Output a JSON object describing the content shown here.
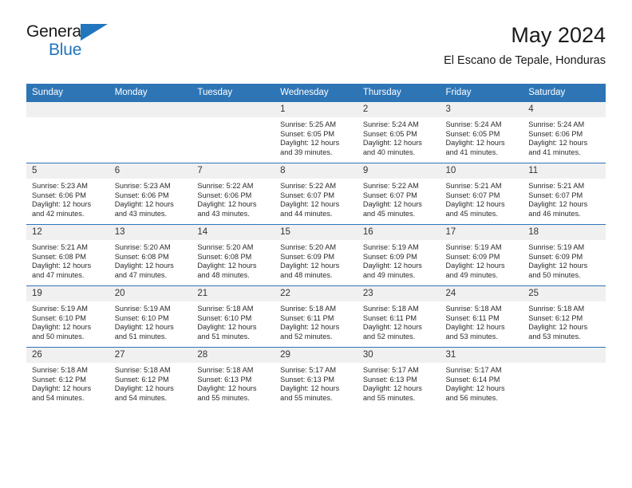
{
  "brand": {
    "name_top": "General",
    "name_bottom": "Blue",
    "accent_color": "#2176bd"
  },
  "header": {
    "title": "May 2024",
    "subtitle": "El Escano de Tepale, Honduras"
  },
  "theme": {
    "header_blue": "#2e75b6",
    "daynum_band": "#f0f0f0",
    "text": "#2b2b2b"
  },
  "weekdays": [
    "Sunday",
    "Monday",
    "Tuesday",
    "Wednesday",
    "Thursday",
    "Friday",
    "Saturday"
  ],
  "labels": {
    "sunrise_prefix": "Sunrise:",
    "sunset_prefix": "Sunset:",
    "daylight_prefix": "Daylight:"
  },
  "weeks": [
    [
      {
        "day": "",
        "line1": "",
        "line2": "",
        "line3": "",
        "line4": ""
      },
      {
        "day": "",
        "line1": "",
        "line2": "",
        "line3": "",
        "line4": ""
      },
      {
        "day": "",
        "line1": "",
        "line2": "",
        "line3": "",
        "line4": ""
      },
      {
        "day": "1",
        "line1": "Sunrise: 5:25 AM",
        "line2": "Sunset: 6:05 PM",
        "line3": "Daylight: 12 hours",
        "line4": "and 39 minutes."
      },
      {
        "day": "2",
        "line1": "Sunrise: 5:24 AM",
        "line2": "Sunset: 6:05 PM",
        "line3": "Daylight: 12 hours",
        "line4": "and 40 minutes."
      },
      {
        "day": "3",
        "line1": "Sunrise: 5:24 AM",
        "line2": "Sunset: 6:05 PM",
        "line3": "Daylight: 12 hours",
        "line4": "and 41 minutes."
      },
      {
        "day": "4",
        "line1": "Sunrise: 5:24 AM",
        "line2": "Sunset: 6:06 PM",
        "line3": "Daylight: 12 hours",
        "line4": "and 41 minutes."
      }
    ],
    [
      {
        "day": "5",
        "line1": "Sunrise: 5:23 AM",
        "line2": "Sunset: 6:06 PM",
        "line3": "Daylight: 12 hours",
        "line4": "and 42 minutes."
      },
      {
        "day": "6",
        "line1": "Sunrise: 5:23 AM",
        "line2": "Sunset: 6:06 PM",
        "line3": "Daylight: 12 hours",
        "line4": "and 43 minutes."
      },
      {
        "day": "7",
        "line1": "Sunrise: 5:22 AM",
        "line2": "Sunset: 6:06 PM",
        "line3": "Daylight: 12 hours",
        "line4": "and 43 minutes."
      },
      {
        "day": "8",
        "line1": "Sunrise: 5:22 AM",
        "line2": "Sunset: 6:07 PM",
        "line3": "Daylight: 12 hours",
        "line4": "and 44 minutes."
      },
      {
        "day": "9",
        "line1": "Sunrise: 5:22 AM",
        "line2": "Sunset: 6:07 PM",
        "line3": "Daylight: 12 hours",
        "line4": "and 45 minutes."
      },
      {
        "day": "10",
        "line1": "Sunrise: 5:21 AM",
        "line2": "Sunset: 6:07 PM",
        "line3": "Daylight: 12 hours",
        "line4": "and 45 minutes."
      },
      {
        "day": "11",
        "line1": "Sunrise: 5:21 AM",
        "line2": "Sunset: 6:07 PM",
        "line3": "Daylight: 12 hours",
        "line4": "and 46 minutes."
      }
    ],
    [
      {
        "day": "12",
        "line1": "Sunrise: 5:21 AM",
        "line2": "Sunset: 6:08 PM",
        "line3": "Daylight: 12 hours",
        "line4": "and 47 minutes."
      },
      {
        "day": "13",
        "line1": "Sunrise: 5:20 AM",
        "line2": "Sunset: 6:08 PM",
        "line3": "Daylight: 12 hours",
        "line4": "and 47 minutes."
      },
      {
        "day": "14",
        "line1": "Sunrise: 5:20 AM",
        "line2": "Sunset: 6:08 PM",
        "line3": "Daylight: 12 hours",
        "line4": "and 48 minutes."
      },
      {
        "day": "15",
        "line1": "Sunrise: 5:20 AM",
        "line2": "Sunset: 6:09 PM",
        "line3": "Daylight: 12 hours",
        "line4": "and 48 minutes."
      },
      {
        "day": "16",
        "line1": "Sunrise: 5:19 AM",
        "line2": "Sunset: 6:09 PM",
        "line3": "Daylight: 12 hours",
        "line4": "and 49 minutes."
      },
      {
        "day": "17",
        "line1": "Sunrise: 5:19 AM",
        "line2": "Sunset: 6:09 PM",
        "line3": "Daylight: 12 hours",
        "line4": "and 49 minutes."
      },
      {
        "day": "18",
        "line1": "Sunrise: 5:19 AM",
        "line2": "Sunset: 6:09 PM",
        "line3": "Daylight: 12 hours",
        "line4": "and 50 minutes."
      }
    ],
    [
      {
        "day": "19",
        "line1": "Sunrise: 5:19 AM",
        "line2": "Sunset: 6:10 PM",
        "line3": "Daylight: 12 hours",
        "line4": "and 50 minutes."
      },
      {
        "day": "20",
        "line1": "Sunrise: 5:19 AM",
        "line2": "Sunset: 6:10 PM",
        "line3": "Daylight: 12 hours",
        "line4": "and 51 minutes."
      },
      {
        "day": "21",
        "line1": "Sunrise: 5:18 AM",
        "line2": "Sunset: 6:10 PM",
        "line3": "Daylight: 12 hours",
        "line4": "and 51 minutes."
      },
      {
        "day": "22",
        "line1": "Sunrise: 5:18 AM",
        "line2": "Sunset: 6:11 PM",
        "line3": "Daylight: 12 hours",
        "line4": "and 52 minutes."
      },
      {
        "day": "23",
        "line1": "Sunrise: 5:18 AM",
        "line2": "Sunset: 6:11 PM",
        "line3": "Daylight: 12 hours",
        "line4": "and 52 minutes."
      },
      {
        "day": "24",
        "line1": "Sunrise: 5:18 AM",
        "line2": "Sunset: 6:11 PM",
        "line3": "Daylight: 12 hours",
        "line4": "and 53 minutes."
      },
      {
        "day": "25",
        "line1": "Sunrise: 5:18 AM",
        "line2": "Sunset: 6:12 PM",
        "line3": "Daylight: 12 hours",
        "line4": "and 53 minutes."
      }
    ],
    [
      {
        "day": "26",
        "line1": "Sunrise: 5:18 AM",
        "line2": "Sunset: 6:12 PM",
        "line3": "Daylight: 12 hours",
        "line4": "and 54 minutes."
      },
      {
        "day": "27",
        "line1": "Sunrise: 5:18 AM",
        "line2": "Sunset: 6:12 PM",
        "line3": "Daylight: 12 hours",
        "line4": "and 54 minutes."
      },
      {
        "day": "28",
        "line1": "Sunrise: 5:18 AM",
        "line2": "Sunset: 6:13 PM",
        "line3": "Daylight: 12 hours",
        "line4": "and 55 minutes."
      },
      {
        "day": "29",
        "line1": "Sunrise: 5:17 AM",
        "line2": "Sunset: 6:13 PM",
        "line3": "Daylight: 12 hours",
        "line4": "and 55 minutes."
      },
      {
        "day": "30",
        "line1": "Sunrise: 5:17 AM",
        "line2": "Sunset: 6:13 PM",
        "line3": "Daylight: 12 hours",
        "line4": "and 55 minutes."
      },
      {
        "day": "31",
        "line1": "Sunrise: 5:17 AM",
        "line2": "Sunset: 6:14 PM",
        "line3": "Daylight: 12 hours",
        "line4": "and 56 minutes."
      },
      {
        "day": "",
        "line1": "",
        "line2": "",
        "line3": "",
        "line4": ""
      }
    ]
  ]
}
